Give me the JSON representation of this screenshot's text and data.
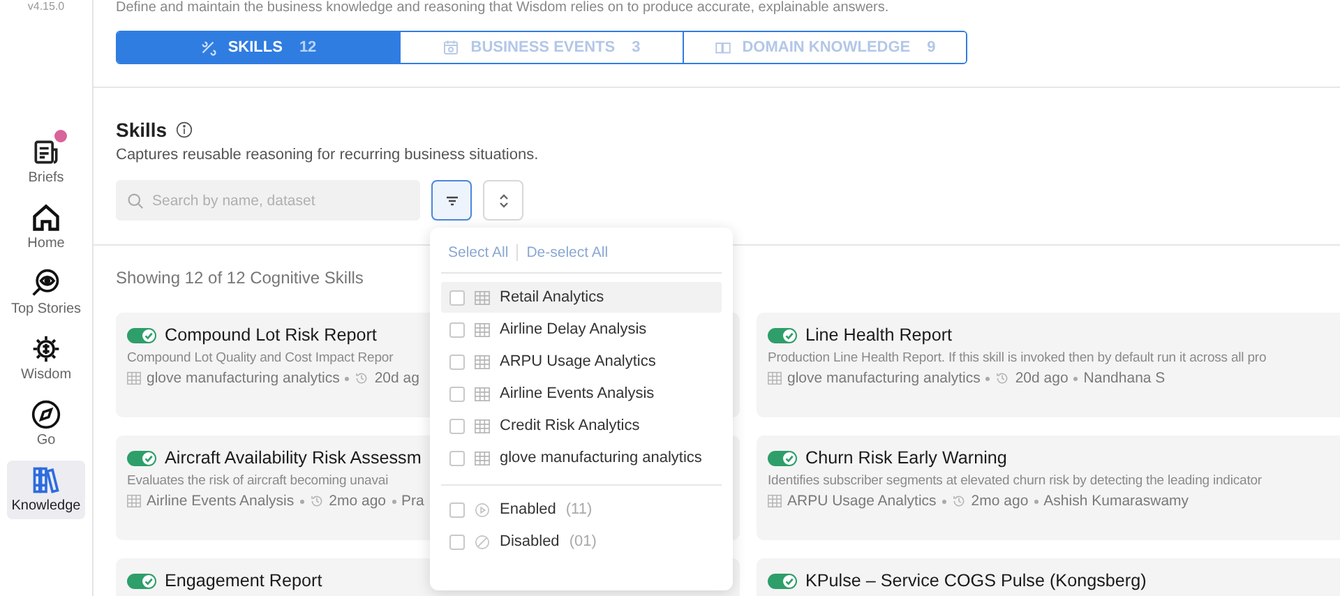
{
  "app": {
    "version": "v4.15.0"
  },
  "sidebar": {
    "items": [
      {
        "label": "Briefs",
        "selected": false,
        "badge": true
      },
      {
        "label": "Home",
        "selected": false,
        "badge": false
      },
      {
        "label": "Top Stories",
        "selected": false,
        "badge": false
      },
      {
        "label": "Wisdom",
        "selected": false,
        "badge": false
      },
      {
        "label": "Go",
        "selected": false,
        "badge": false
      },
      {
        "label": "Knowledge",
        "selected": true,
        "badge": false
      }
    ]
  },
  "header": {
    "description": "Define and maintain the business knowledge and reasoning that Wisdom relies on to produce accurate, explainable answers."
  },
  "tabs": [
    {
      "label": "SKILLS",
      "count": "12",
      "selected": true
    },
    {
      "label": "BUSINESS EVENTS",
      "count": "3",
      "selected": false
    },
    {
      "label": "DOMAIN KNOWLEDGE",
      "count": "9",
      "selected": false
    }
  ],
  "section": {
    "title": "Skills",
    "subtitle": "Captures reusable reasoning for recurring business situations.",
    "search": {
      "placeholder": "Search by name, dataset"
    },
    "filter_expanded": true
  },
  "results_summary": "Showing 12 of 12 Cognitive Skills",
  "cards": [
    {
      "title": "Compound Lot Risk Report",
      "enabled": true,
      "description": "Compound Lot Quality and Cost Impact Repor",
      "dataset": "glove manufacturing analytics",
      "time": "20d ag"
    },
    {
      "title": "Line Health Report",
      "enabled": true,
      "description": "Production Line Health Report. If this skill is invoked then by default run it across all pro",
      "dataset": "glove manufacturing analytics",
      "time": "20d ago",
      "author": "Nandhana S"
    },
    {
      "title": "Aircraft Availability Risk Assessm",
      "enabled": true,
      "description": "Evaluates the risk of aircraft becoming unavai",
      "dataset": "Airline Events Analysis",
      "time": "2mo ago",
      "author": "Pra"
    },
    {
      "title": "Churn Risk Early Warning",
      "enabled": true,
      "description": "Identifies subscriber segments at elevated churn risk by detecting the leading indicator",
      "dataset": "ARPU Usage Analytics",
      "time": "2mo ago",
      "author": "Ashish Kumaraswamy"
    },
    {
      "title": "Engagement Report",
      "enabled": true
    },
    {
      "title": "KPulse – Service COGS Pulse (Kongsberg)",
      "enabled": true
    }
  ],
  "filter_menu": {
    "select_all": "Select All",
    "deselect_all": "De-select All",
    "datasets": [
      {
        "label": "Retail Analytics",
        "checked": false,
        "hovered": true
      },
      {
        "label": "Airline Delay Analysis",
        "checked": false,
        "hovered": false
      },
      {
        "label": "ARPU Usage Analytics",
        "checked": false,
        "hovered": false
      },
      {
        "label": "Airline Events Analysis",
        "checked": false,
        "hovered": false
      },
      {
        "label": "Credit Risk Analytics",
        "checked": false,
        "hovered": false
      },
      {
        "label": "glove manufacturing analytics",
        "checked": false,
        "hovered": false
      }
    ],
    "statuses": [
      {
        "kind": "enabled",
        "label": "Enabled",
        "count": "(11)",
        "checked": false
      },
      {
        "kind": "disabled",
        "label": "Disabled",
        "count": "(01)",
        "checked": false
      }
    ]
  }
}
